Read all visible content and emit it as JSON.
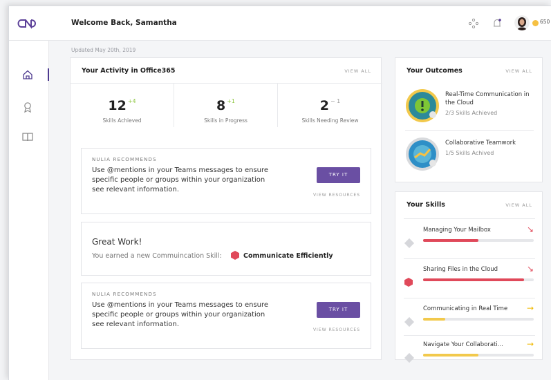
{
  "header": {
    "welcome": "Welcome Back, Samantha",
    "points": "650"
  },
  "updated": "Updated May 20th, 2019",
  "activity": {
    "title": "Your Activity in Office365",
    "view_all": "VIEW ALL",
    "stats": [
      {
        "value": "12",
        "delta": "+4",
        "delta_color": "#8cc63f",
        "label": "Skills Achieved"
      },
      {
        "value": "8",
        "delta": "+1",
        "delta_color": "#8cc63f",
        "label": "Skills in Progress"
      },
      {
        "value": "2",
        "delta": "− 1",
        "delta_color": "#999999",
        "label": "Skills Needing Review"
      }
    ]
  },
  "recommend1": {
    "label": "NULIA RECOMMENDS",
    "text": "Use @mentions in your Teams messages to ensure specific people or groups within your organization see relevant information.",
    "try_label": "TRY IT",
    "resources": "VIEW RESOURCES"
  },
  "great": {
    "title": "Great Work!",
    "subtitle": "You earned a new Commuincation Skill:",
    "skill": "Communicate Efficiently"
  },
  "recommend2": {
    "label": "NULIA RECOMMENDS",
    "text": "Use @mentions in your Teams messages to ensure specific people or groups within your organization see relevant information.",
    "try_label": "TRY IT",
    "resources": "VIEW RESOURCES"
  },
  "outcomes": {
    "title": "Your Outcomes",
    "view_all": "VIEW ALL",
    "items": [
      {
        "title": "Real-Time Communication in the Cloud",
        "progress": "2/3 Skills Achieved"
      },
      {
        "title": "Collaborative Teamwork",
        "progress": "1/5 Skills Achived"
      }
    ]
  },
  "skills": {
    "title": "Your Skills",
    "view_all": "VIEW ALL",
    "items": [
      {
        "name": "Managing Your Mailbox",
        "arrow": "↘",
        "arrow_color": "#e0495a",
        "fill_color": "#e0495a",
        "level": 0.5
      },
      {
        "name": "Sharing Files in the Cloud",
        "arrow": "↘",
        "arrow_color": "#e0495a",
        "fill_color": "#e0495a",
        "level": 0.91
      },
      {
        "name": "Communicating in Real Time",
        "arrow": "→",
        "arrow_color": "#f0b800",
        "fill_color": "#f2c94c",
        "level": 0.2
      },
      {
        "name": "Navigate Your Collaborati...",
        "arrow": "→",
        "arrow_color": "#f0b800",
        "fill_color": "#f2c94c",
        "level": 0.5
      }
    ]
  },
  "colors": {
    "accent": "#6a4fa3",
    "nav_active": "#4d3a8f"
  }
}
